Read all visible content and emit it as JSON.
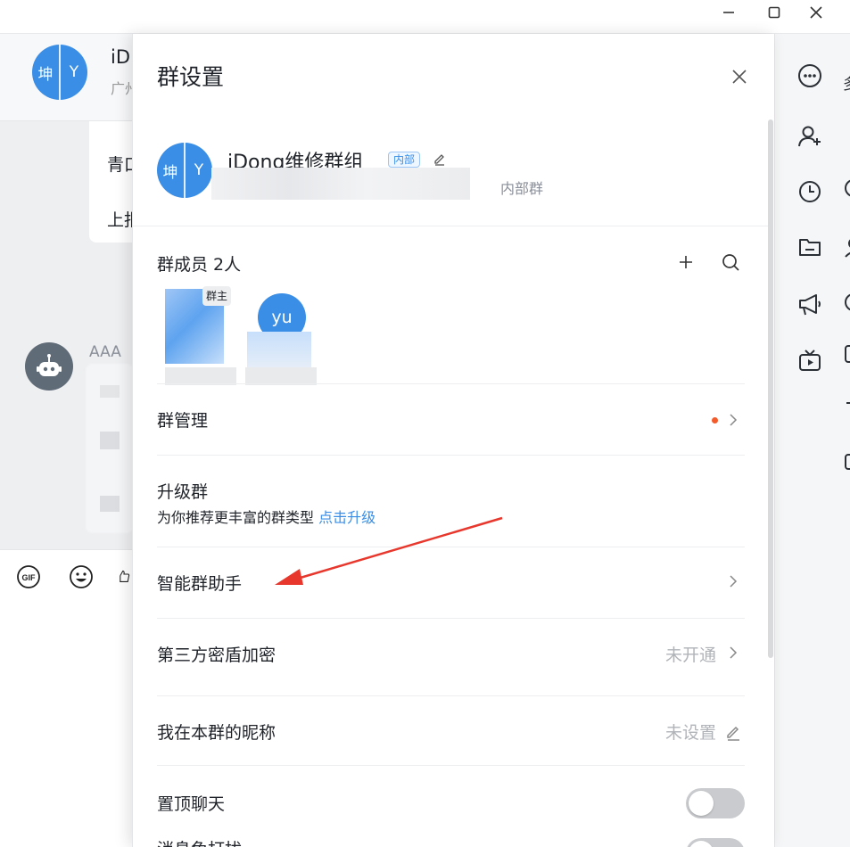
{
  "window": {
    "minimize_icon": "minimize-icon",
    "maximize_icon": "maximize-icon",
    "close_icon": "close-icon"
  },
  "chat_header": {
    "avatar_left": "坤",
    "avatar_right": "Y",
    "title": "iD",
    "subtitle": "广州"
  },
  "chat": {
    "messages": [
      "青口",
      "上报"
    ],
    "bot_name": "AAA"
  },
  "toolbar": {
    "icons": [
      "gif-icon",
      "emoji-icon",
      "thumbs-up-icon"
    ]
  },
  "right_rail": {
    "icons": [
      "more-icon",
      "add-member-icon",
      "history-icon",
      "folder-icon",
      "announcement-icon",
      "live-icon"
    ],
    "peek_text": "多"
  },
  "settings": {
    "title": "群设置",
    "group": {
      "avatar_left": "坤",
      "avatar_right": "Y",
      "name": "iDong维修群组",
      "tag": "内部",
      "desc_suffix": "内部群"
    },
    "members": {
      "label": "群成员 2人",
      "owner_tag": "群主",
      "member2_initials": "yu"
    },
    "rows": {
      "manage": {
        "label": "群管理"
      },
      "upgrade": {
        "label": "升级群",
        "sub": "为你推荐更丰富的群类型",
        "sub_link": "点击升级"
      },
      "assistant": {
        "label": "智能群助手"
      },
      "encryption": {
        "label": "第三方密盾加密",
        "value": "未开通"
      },
      "nickname": {
        "label": "我在本群的昵称",
        "value": "未设置"
      },
      "pin": {
        "label": "置顶聊天",
        "enabled": false
      },
      "mute": {
        "label": "消息免打扰",
        "enabled": false
      }
    }
  },
  "colors": {
    "accent": "#3a8ee6",
    "arrow": "#e8372c",
    "dot": "#f45a2a"
  }
}
